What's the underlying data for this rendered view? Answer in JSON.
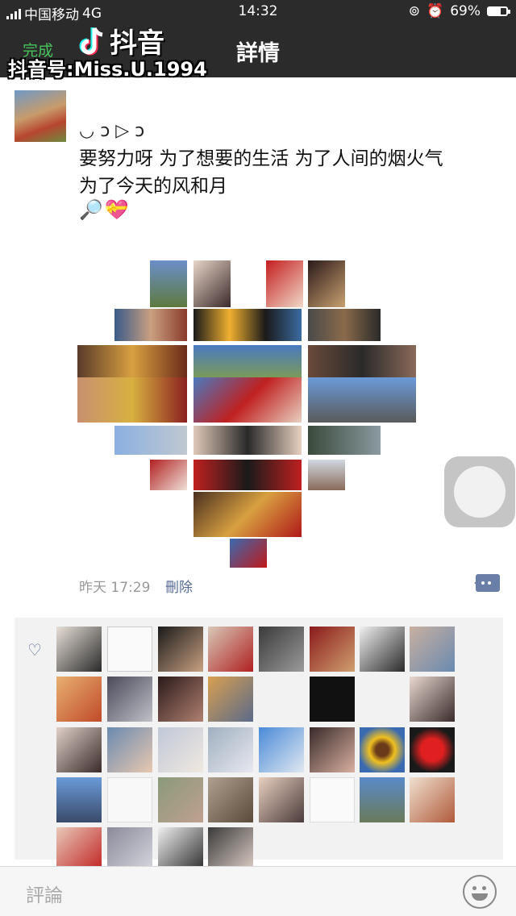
{
  "status_bar": {
    "carrier": "中国移动",
    "network": "4G",
    "time": "14:32",
    "battery": "69%",
    "battery_level": 0.69
  },
  "nav": {
    "back_label": "完成",
    "title": "詳情"
  },
  "watermark": {
    "app_name": "抖音",
    "douyin_id": "抖音号:Miss.U.1994"
  },
  "post": {
    "emoji_line": "◡ ɔ ▷ ɔ",
    "text_line1": "要努力呀 为了想要的生活 为了人间的烟火气",
    "text_line2": "为了今天的风和月",
    "icons": [
      "🔎",
      "💝"
    ],
    "time": "昨天 17:29",
    "delete_label": "刪除"
  },
  "colors": {
    "bar": "#2b2b2b",
    "link": "#576b95",
    "accent_green": "#46c35a"
  },
  "comment_input": {
    "placeholder": "評論"
  }
}
